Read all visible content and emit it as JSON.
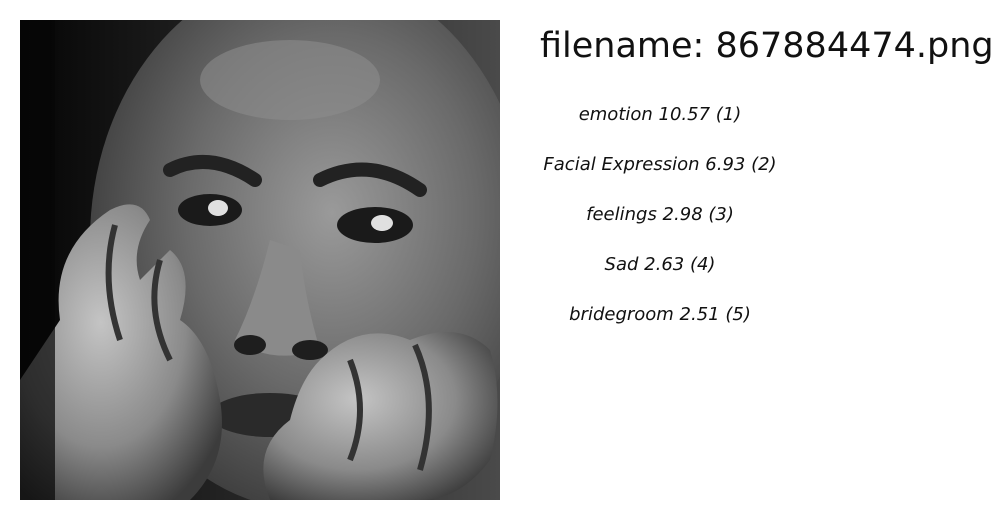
{
  "filename_text": "filename: 867884474.png",
  "image": {
    "subject": "grayscale close-up photo of a man resting his face on his hands",
    "palette": [
      "#0a0a0a",
      "#6f6f6f",
      "#c8c8c8"
    ]
  },
  "labels": [
    {
      "text": "emotion 10.57 (1)"
    },
    {
      "text": "Facial Expression  6.93 (2)"
    },
    {
      "text": "feelings  2.98 (3)"
    },
    {
      "text": "Sad  2.63 (4)"
    },
    {
      "text": "bridegroom  2.51 (5)"
    }
  ]
}
